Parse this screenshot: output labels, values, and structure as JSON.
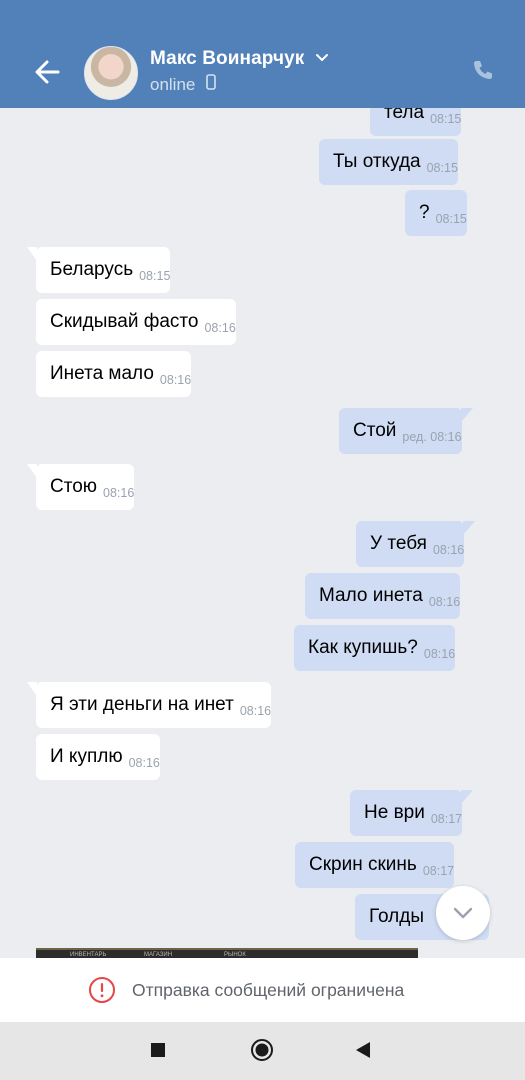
{
  "header": {
    "contact_name": "Макс Воинарчук",
    "status": "online"
  },
  "messages": [
    {
      "dir": "out",
      "text": "тела",
      "time": "08:15"
    },
    {
      "dir": "out",
      "text": "Ты откуда",
      "time": "08:15"
    },
    {
      "dir": "out",
      "text": "?",
      "time": "08:15"
    },
    {
      "dir": "in",
      "text": "Беларусь",
      "time": "08:15"
    },
    {
      "dir": "in",
      "text": "Скидывай фасто",
      "time": "08:16"
    },
    {
      "dir": "in",
      "text": "Инета мало",
      "time": "08:16"
    },
    {
      "dir": "out",
      "text": "Стой",
      "time": "ред. 08:16"
    },
    {
      "dir": "in",
      "text": "Стою",
      "time": "08:16"
    },
    {
      "dir": "out",
      "text": "У тебя",
      "time": "08:16"
    },
    {
      "dir": "out",
      "text": "Мало инета",
      "time": "08:16"
    },
    {
      "dir": "out",
      "text": "Как купишь?",
      "time": "08:16"
    },
    {
      "dir": "in",
      "text": "Я эти деньги на инет",
      "time": "08:16"
    },
    {
      "dir": "in",
      "text": "И куплю",
      "time": "08:16"
    },
    {
      "dir": "out",
      "text": "Не ври",
      "time": "08:17"
    },
    {
      "dir": "out",
      "text": "Скрин скинь",
      "time": "08:17"
    },
    {
      "dir": "out",
      "text": "Голды",
      "time": ""
    }
  ],
  "image_preview_labels": [
    "ИНВЕНТАРЬ",
    "МАГАЗИН",
    "РЫНОК"
  ],
  "restriction": {
    "text": "Отправка сообщений ограничена"
  },
  "colors": {
    "header_bg": "#5181b8",
    "chat_bg": "#ebedf0",
    "incoming_bubble": "#ffffff",
    "outgoing_bubble": "#cfdcf4",
    "warning_red": "#e64646"
  },
  "icons": {
    "back": "arrow-left-icon",
    "call": "phone-icon",
    "chevron": "chevron-down-icon",
    "mobile": "mobile-phone-icon",
    "scroll_down": "chevron-down-icon",
    "warning": "exclamation-circle-icon",
    "nav_recent": "square-icon",
    "nav_home": "circle-icon",
    "nav_back": "triangle-back-icon"
  }
}
